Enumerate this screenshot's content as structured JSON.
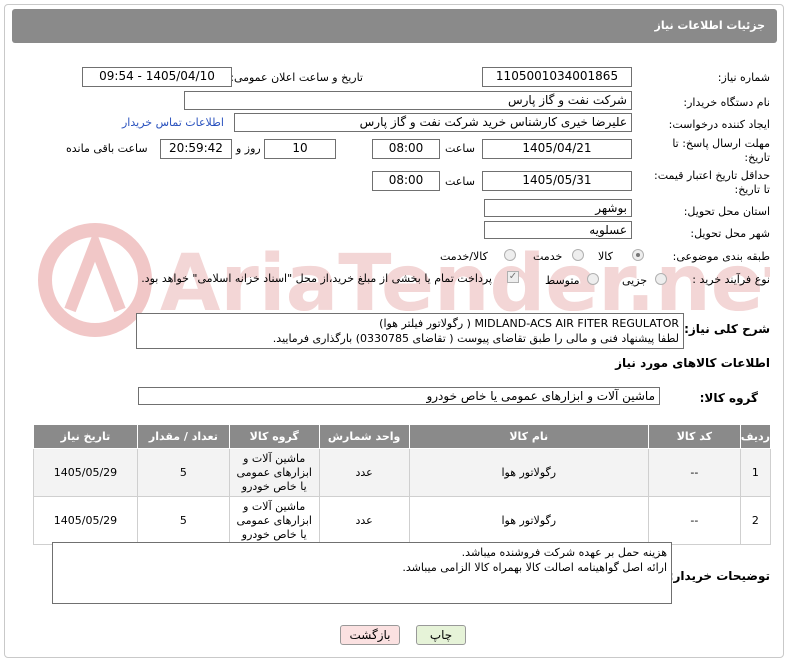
{
  "header": {
    "title": "جزئیات اطلاعات نیاز"
  },
  "fields": {
    "need_number_label": "شماره نیاز:",
    "need_number": "1105001034001865",
    "announce_label": "تاریخ و ساعت اعلان عمومی:",
    "announce_value": "1405/04/10 - 09:54",
    "buyer_org_label": "نام دستگاه خریدار:",
    "buyer_org": "شرکت نفت و گاز پارس",
    "creator_label": "ایجاد کننده درخواست:",
    "creator": "علیرضا  خیری کارشناس خرید  شرکت نفت و گاز پارس",
    "contact_link": "اطلاعات تماس خریدار",
    "deadline_label_1": "مهلت ارسال پاسخ: تا",
    "deadline_label_2": "تاریخ:",
    "deadline_date": "1405/04/21",
    "time_label": "ساعت",
    "deadline_time": "08:00",
    "days_value": "10",
    "days_label": "روز و",
    "remaining_time": "20:59:42",
    "remaining_label": "ساعت باقی مانده",
    "validity_label_1": "حداقل تاریخ اعتبار قیمت:",
    "validity_label_2": "تا تاریخ:",
    "validity_date": "1405/05/31",
    "validity_time": "08:00",
    "province_label": "استان محل تحویل:",
    "province": "بوشهر",
    "city_label": "شهر محل تحویل:",
    "city": "عسلویه",
    "category_label": "طبقه بندی موضوعی:",
    "category_options": [
      "کالا",
      "خدمت",
      "کالا/خدمت"
    ],
    "process_label": "نوع فرآیند خرید :",
    "process_options": [
      "جزیی",
      "متوسط"
    ],
    "payment_note": "پرداخت تمام یا بخشی از مبلغ خرید،از محل \"اسناد خزانه اسلامی\" خواهد بود.",
    "description_label": "شرح کلی نیاز:",
    "description_line1": "MIDLAND-ACS AIR FITER REGULATOR ( رگولاتور فیلتر هوا)",
    "description_line2": "لطفا پیشنهاد فنی و مالی را طبق تقاضای پیوست ( تقاضای 0330785) بارگذاری فرمایید.",
    "goods_info_title": "اطلاعات کالاهای مورد نیاز",
    "goods_group_label": "گروه کالا:",
    "goods_group": "ماشین آلات و ابزارهای عمومی یا خاص خودرو",
    "buyer_notes_label": "توضیحات خریدار:",
    "buyer_notes_line1": "هزینه حمل بر عهده شرکت فروشنده میباشد.",
    "buyer_notes_line2": "ارائه اصل گواهینامه اصالت کالا بهمراه کالا الزامی میباشد."
  },
  "table": {
    "headers": [
      "ردیف",
      "کد کالا",
      "نام کالا",
      "واحد شمارش",
      "گروه کالا",
      "تعداد / مقدار",
      "تاریخ نیاز"
    ],
    "rows": [
      [
        "1",
        "--",
        "رگولاتور هوا",
        "عدد",
        "ماشین آلات و ابزارهای عمومی یا خاص خودرو",
        "5",
        "1405/05/29"
      ],
      [
        "2",
        "--",
        "رگولاتور هوا",
        "عدد",
        "ماشین آلات و ابزارهای عمومی یا خاص خودرو",
        "5",
        "1405/05/29"
      ]
    ]
  },
  "buttons": {
    "print": "چاپ",
    "back": "بازگشت"
  },
  "watermark": {
    "text": "AriaTender.net"
  },
  "colors": {
    "header_bg": "#8a8a8a",
    "link": "#2a52be",
    "print_btn": "#e6f3d8",
    "back_btn": "#fbe1e1"
  }
}
